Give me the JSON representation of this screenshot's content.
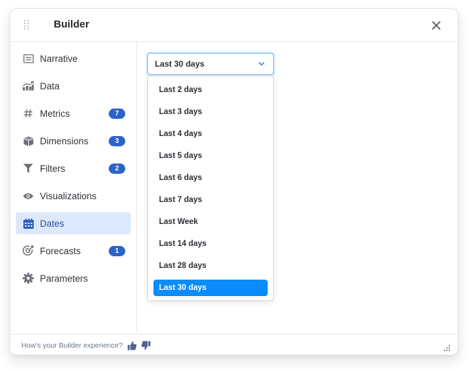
{
  "header": {
    "title": "Builder",
    "drag_icon": "drag-handle-icon",
    "close_icon": "close-icon"
  },
  "sidebar": {
    "items": [
      {
        "label": "Narrative",
        "icon": "narrative-icon",
        "badge": null,
        "active": false
      },
      {
        "label": "Data",
        "icon": "data-chart-icon",
        "badge": null,
        "active": false
      },
      {
        "label": "Metrics",
        "icon": "hash-icon",
        "badge": "7",
        "active": false
      },
      {
        "label": "Dimensions",
        "icon": "cube-icon",
        "badge": "3",
        "active": false
      },
      {
        "label": "Filters",
        "icon": "filter-icon",
        "badge": "2",
        "active": false
      },
      {
        "label": "Visualizations",
        "icon": "eye-icon",
        "badge": null,
        "active": false
      },
      {
        "label": "Dates",
        "icon": "calendar-icon",
        "badge": null,
        "active": true
      },
      {
        "label": "Forecasts",
        "icon": "forecast-target-icon",
        "badge": "1",
        "active": false
      },
      {
        "label": "Parameters",
        "icon": "gear-icon",
        "badge": null,
        "active": false
      }
    ]
  },
  "date_select": {
    "value": "Last 30 days",
    "chevron_icon": "chevron-down-icon",
    "options": [
      "Last 2 days",
      "Last 3 days",
      "Last 4 days",
      "Last 5 days",
      "Last 6 days",
      "Last 7 days",
      "Last Week",
      "Last 14 days",
      "Last 28 days",
      "Last 30 days"
    ],
    "selected_index": 9
  },
  "footer": {
    "prompt": "How's your Builder experience?",
    "thumbs_up_icon": "thumbs-up-icon",
    "thumbs_down_icon": "thumbs-down-icon",
    "resize_icon": "resize-grip-icon"
  },
  "colors": {
    "accent": "#0a8cfa",
    "badge": "#2d62c9",
    "active_bg": "#dde9fb",
    "active_text": "#2c4f9e"
  }
}
